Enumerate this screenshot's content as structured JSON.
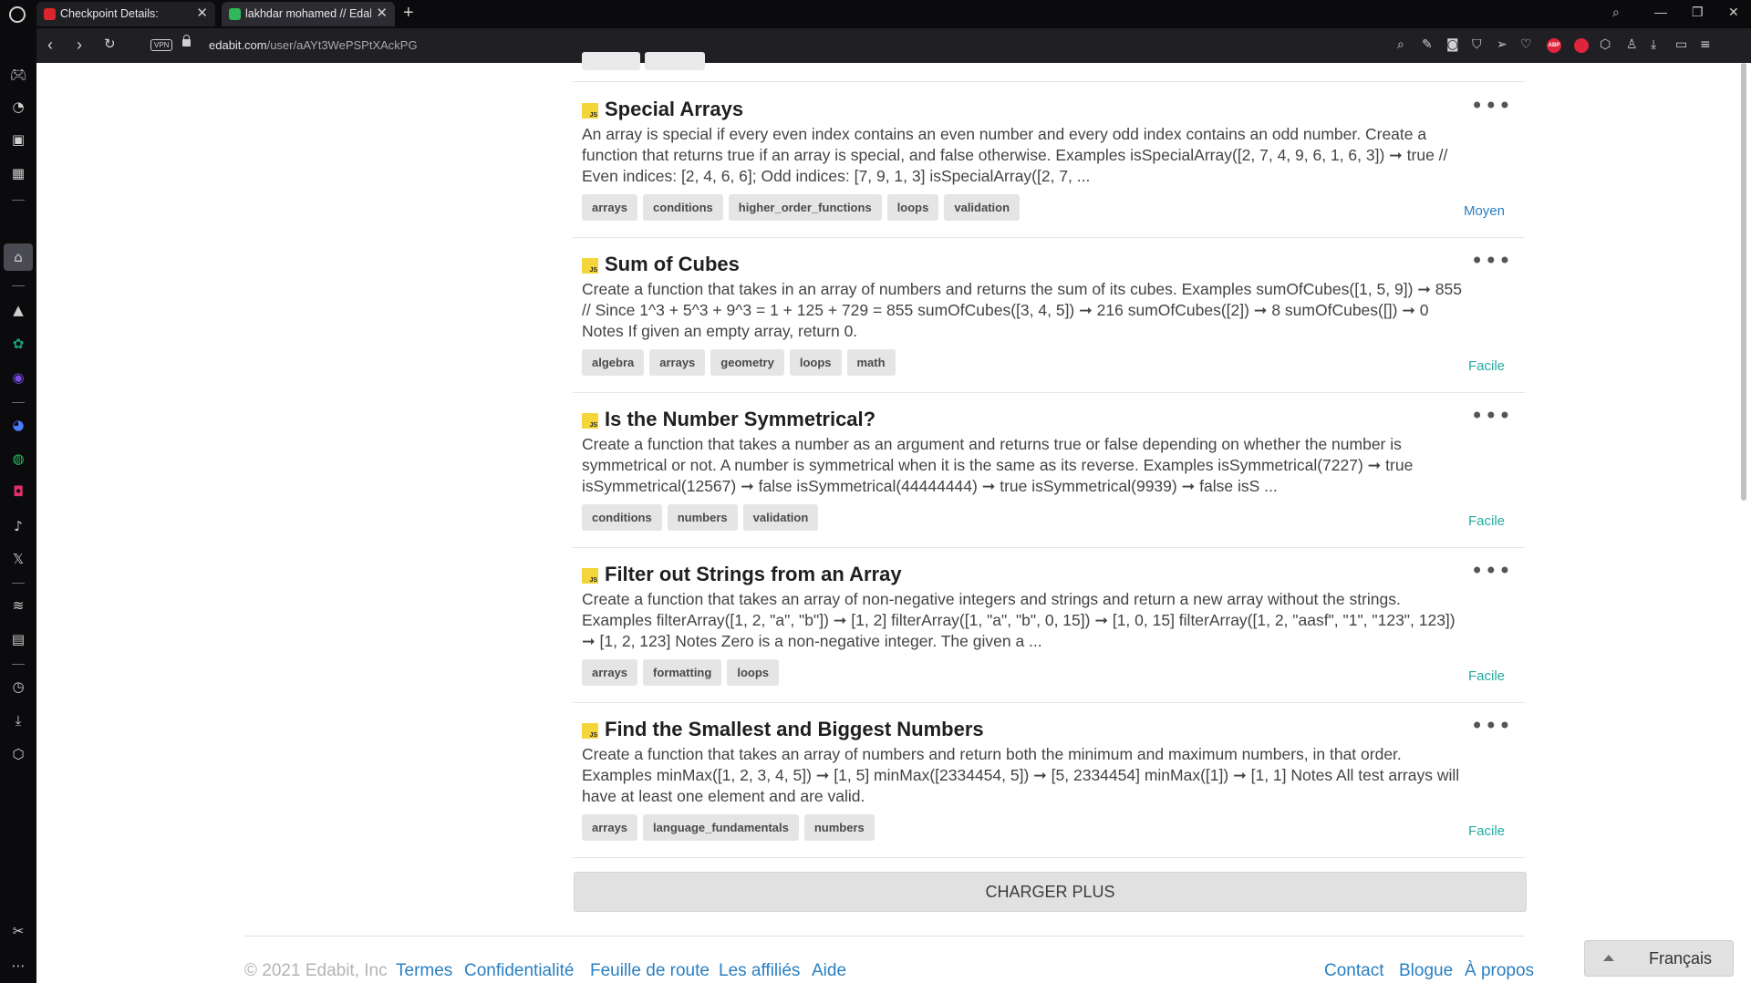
{
  "browser": {
    "tabs": [
      {
        "title": "Checkpoint Details:",
        "favicon_color": "#d9262e",
        "active": false
      },
      {
        "title": "lakhdar mohamed // Edabit",
        "favicon_color": "#2fb85a",
        "active": true
      }
    ],
    "new_tab": "+",
    "url_domain": "edabit.com",
    "url_path": "/user/aAYt3WePSPtXAckPG",
    "vpn_label": "VPN",
    "abp_label": "ABP"
  },
  "challenges": [
    {
      "title": "Special Arrays",
      "description": "An array is special if every even index contains an even number and every odd index contains an odd number. Create a function that returns true if an array is special, and false otherwise. Examples isSpecialArray([2, 7, 4, 9, 6, 1, 6, 3]) ➞ true // Even indices: [2, 4, 6, 6]; Odd indices: [7, 9, 1, 3] isSpecialArray([2, 7, ...",
      "tags": [
        "arrays",
        "conditions",
        "higher_order_functions",
        "loops",
        "validation"
      ],
      "difficulty": "Moyen",
      "difficulty_color": "#2a7fc1"
    },
    {
      "title": "Sum of Cubes",
      "description": "Create a function that takes in an array of numbers and returns the sum of its cubes. Examples sumOfCubes([1, 5, 9]) ➞ 855 // Since 1^3 + 5^3 + 9^3 = 1 + 125 + 729 = 855 sumOfCubes([3, 4, 5]) ➞ 216 sumOfCubes([2]) ➞ 8 sumOfCubes([]) ➞ 0 Notes If given an empty array, return 0.",
      "tags": [
        "algebra",
        "arrays",
        "geometry",
        "loops",
        "math"
      ],
      "difficulty": "Facile",
      "difficulty_color": "#26a9a0"
    },
    {
      "title": "Is the Number Symmetrical?",
      "description": "Create a function that takes a number as an argument and returns true or false depending on whether the number is symmetrical or not. A number is symmetrical when it is the same as its reverse. Examples isSymmetrical(7227) ➞ true isSymmetrical(12567) ➞ false isSymmetrical(44444444) ➞ true isSymmetrical(9939) ➞ false isS ...",
      "tags": [
        "conditions",
        "numbers",
        "validation"
      ],
      "difficulty": "Facile",
      "difficulty_color": "#26a9a0"
    },
    {
      "title": "Filter out Strings from an Array",
      "description": "Create a function that takes an array of non-negative integers and strings and return a new array without the strings. Examples filterArray([1, 2, \"a\", \"b\"]) ➞ [1, 2] filterArray([1, \"a\", \"b\", 0, 15]) ➞ [1, 0, 15] filterArray([1, 2, \"aasf\", \"1\", \"123\", 123]) ➞ [1, 2, 123] Notes Zero is a non-negative integer. The given a ...",
      "tags": [
        "arrays",
        "formatting",
        "loops"
      ],
      "difficulty": "Facile",
      "difficulty_color": "#26a9a0"
    },
    {
      "title": "Find the Smallest and Biggest Numbers",
      "description": "Create a function that takes an array of numbers and return both the minimum and maximum numbers, in that order. Examples minMax([1, 2, 3, 4, 5]) ➞ [1, 5] minMax([2334454, 5]) ➞ [5, 2334454] minMax([1]) ➞ [1, 1] Notes All test arrays will have at least one element and are valid.",
      "tags": [
        "arrays",
        "language_fundamentals",
        "numbers"
      ],
      "difficulty": "Facile",
      "difficulty_color": "#26a9a0"
    }
  ],
  "js_badge": "JS",
  "more_label": "•••",
  "load_more_label": "CHARGER PLUS",
  "footer": {
    "copyright": "© 2021 Edabit, Inc",
    "left_links": [
      "Termes",
      "Confidentialité",
      "Feuille de route",
      "Les affiliés",
      "Aide"
    ],
    "right_links": [
      "Contact",
      "Blogue",
      "À propos"
    ]
  },
  "language_selector": "Français"
}
